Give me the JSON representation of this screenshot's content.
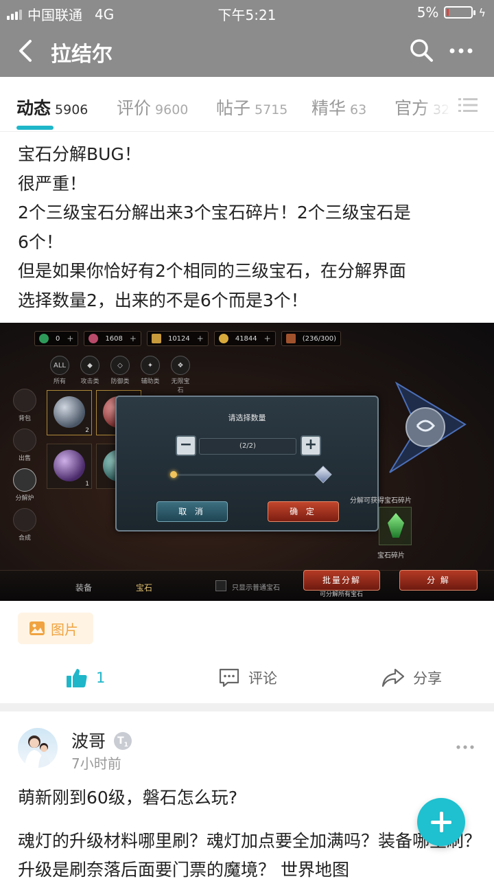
{
  "status_bar": {
    "carrier": "中国联通",
    "network": "4G",
    "time": "下午5:21",
    "battery": "5%"
  },
  "nav": {
    "title": "拉结尔"
  },
  "tabs": [
    {
      "label": "动态",
      "count": "5906"
    },
    {
      "label": "评价",
      "count": "9600"
    },
    {
      "label": "帖子",
      "count": "5715"
    },
    {
      "label": "精华",
      "count": "63"
    },
    {
      "label": "官方",
      "count": "32"
    }
  ],
  "post1": {
    "lines": [
      "宝石分解BUG！",
      "很严重！",
      "2个三级宝石分解出来3个宝石碎片！2个三级宝石是",
      "6个！",
      "但是如果你恰好有2个相同的三级宝石，在分解界面",
      "选择数量2，出来的不是6个而是3个！"
    ],
    "image_tag": "图片",
    "likes": "1",
    "comment_label": "评论",
    "share_label": "分享"
  },
  "game_shot": {
    "resources": [
      "0",
      "1608",
      "10124",
      "41844",
      "(236/300)"
    ],
    "categories": [
      "所有",
      "攻击类",
      "防御类",
      "辅助类",
      "无限宝石"
    ],
    "side_menu": [
      "背包",
      "出售",
      "分解炉",
      "合成"
    ],
    "slot_qty": [
      "2",
      "1"
    ],
    "dialog_title": "请选择数量",
    "stepper_value": "(2/2)",
    "cancel": "取 消",
    "confirm": "确 定",
    "shard_hint": "分解可获得宝石碎片",
    "shard_name": "宝石碎片",
    "bottom_tabs": [
      "装备",
      "宝石"
    ],
    "only_show": "只显示普通宝石",
    "batch_btn": "批量分解",
    "batch_sub": "可分解所有宝石",
    "decompose_btn": "分 解"
  },
  "post2": {
    "author": "波哥",
    "badge": "T",
    "badge_level": "1",
    "time": "7小时前",
    "title": "萌新刚到60级，磐石怎么玩?",
    "body": "魂灯的升级材料哪里刷？魂灯加点要全加满吗？装备哪里刷？升级是刷奈落后面要门票的魔境？ 世界地图"
  },
  "colors": {
    "accent": "#1fb6c9",
    "header_gray": "#8c8c8c",
    "tag_orange": "#f0a340"
  }
}
